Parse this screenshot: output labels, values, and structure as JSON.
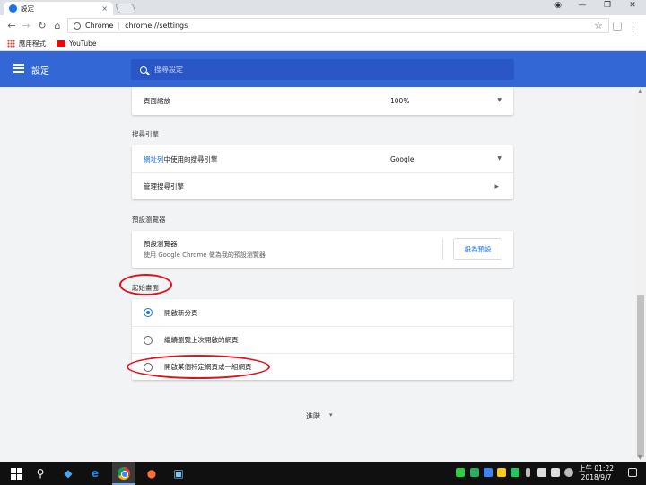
{
  "browser": {
    "tab_title": "設定",
    "tab_close": "×",
    "url_scheme": "Chrome",
    "url_host": "chrome://",
    "url_path": "settings",
    "star": "☆",
    "menu": "⋮",
    "nav": {
      "back": "←",
      "forward": "→",
      "reload": "↻",
      "home": "⌂"
    },
    "window": {
      "account": "◉",
      "minimize": "—",
      "restore": "❐",
      "close": "✕"
    }
  },
  "bookmarks": [
    {
      "label": "應用程式",
      "icon": "apps-grid-icon"
    },
    {
      "label": "YouTube",
      "icon": "youtube-icon"
    }
  ],
  "header": {
    "title": "設定",
    "search_placeholder": "搜尋設定"
  },
  "sections": {
    "zoom": {
      "label": "頁面縮放",
      "value": "100%"
    },
    "search_engine": {
      "title": "搜尋引擎",
      "row1_link": "網址列",
      "row1_rest": "中使用的搜尋引擎",
      "row1_value": "Google",
      "row2_label": "管理搜尋引擎"
    },
    "default_browser": {
      "title": "預設瀏覽器",
      "label": "預設瀏覽器",
      "sublabel": "使用 Google Chrome 做為我的預設瀏覽器",
      "button": "設為預設"
    },
    "startup": {
      "title": "起始畫面",
      "options": [
        {
          "label": "開啟新分頁",
          "selected": true
        },
        {
          "label": "繼續瀏覽上次開啟的網頁",
          "selected": false
        },
        {
          "label": "開啟某個特定網頁或一組網頁",
          "selected": false
        }
      ]
    },
    "advanced": {
      "label": "進階",
      "caret": "▾"
    }
  },
  "taskbar": {
    "search": "⚲",
    "time": "上午 01:22",
    "date": "2018/9/7"
  },
  "colors": {
    "header_blue": "#3367d6",
    "accent": "#1a73e8",
    "annotation_red": "#e3101a"
  }
}
